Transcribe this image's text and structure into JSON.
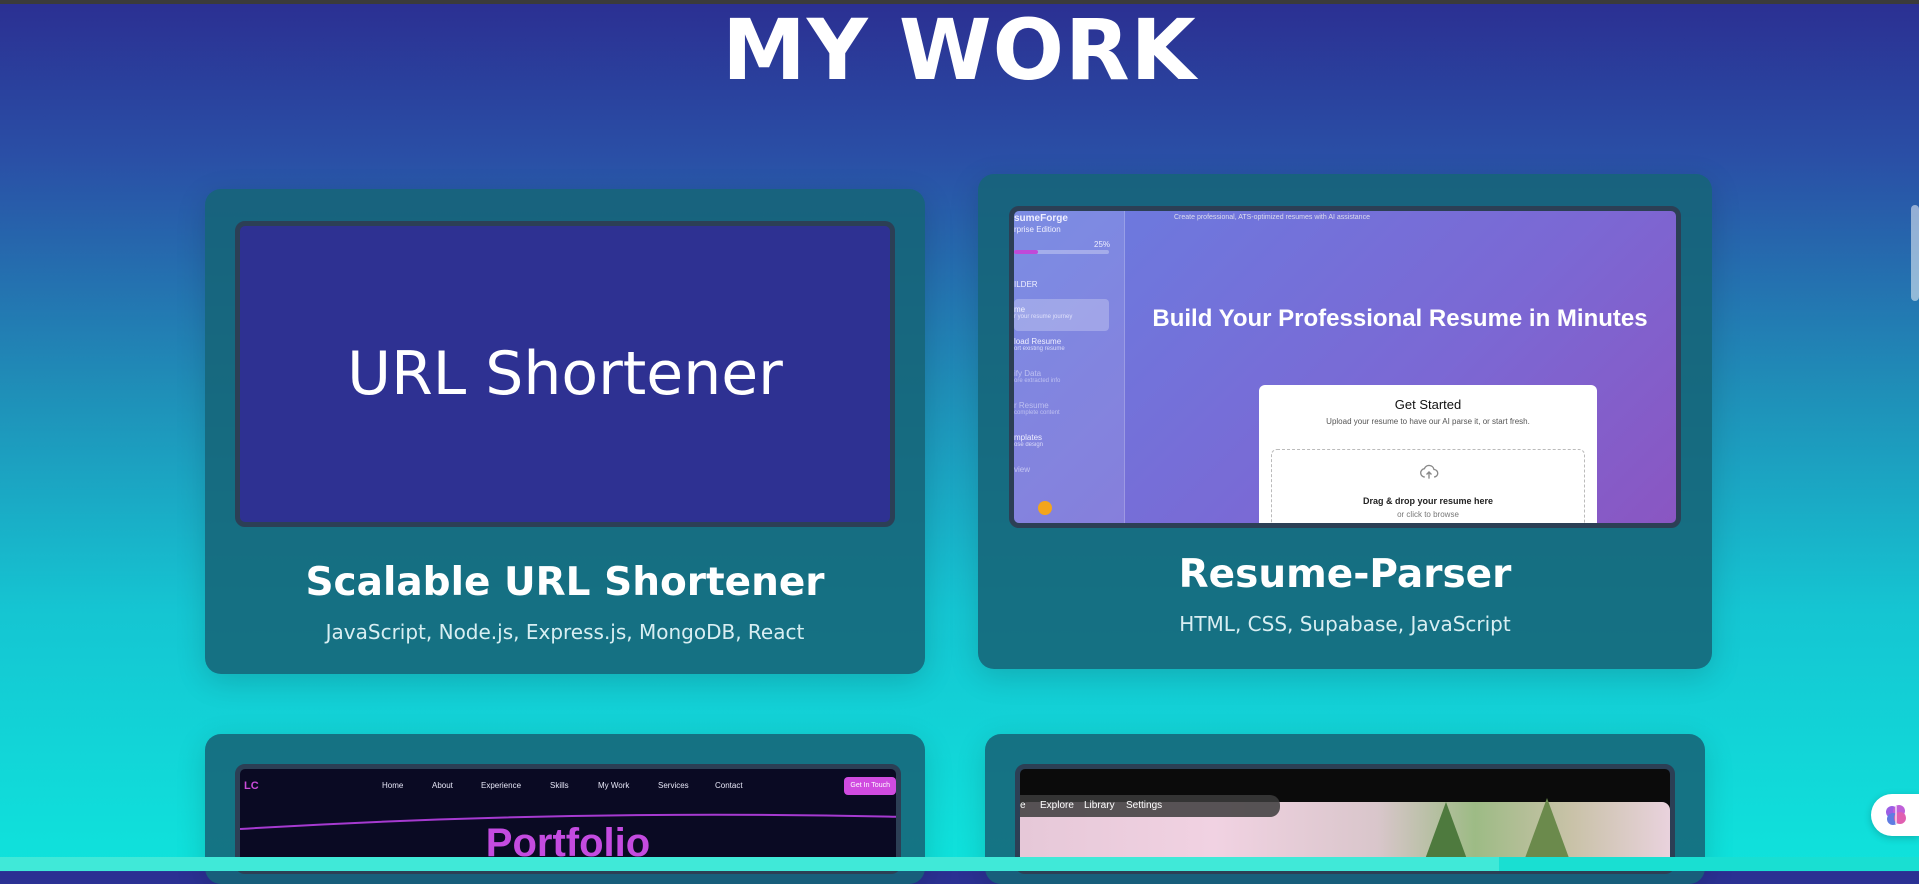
{
  "page": {
    "title": "MY WORK"
  },
  "projects": [
    {
      "thumbnail_text": "URL Shortener",
      "title": "Scalable URL Shortener",
      "tech": "JavaScript, Node.js, Express.js, MongoDB, React"
    },
    {
      "title": "Resume-Parser",
      "tech": "HTML, CSS, Supabase, JavaScript",
      "preview": {
        "app_name": "sumeForge",
        "edition": "rprise Edition",
        "progress_label": "25%",
        "progress": 0.25,
        "tagline": "Create professional, ATS-optimized resumes with AI assistance",
        "section_label": "ILDER",
        "sidebar_items": [
          {
            "label": "me",
            "sub": "r your resume journey"
          },
          {
            "label": "load Resume",
            "sub": "ort existing resume"
          },
          {
            "label": "ify Data",
            "sub": "ore extracted info"
          },
          {
            "label": "r Resume",
            "sub": "complete content"
          },
          {
            "label": "mplates",
            "sub": "ose design"
          },
          {
            "label": "view",
            "sub": ""
          }
        ],
        "headline": "Build Your Professional Resume in Minutes",
        "card_title": "Get Started",
        "card_subtitle": "Upload your resume to have our AI parse it, or start fresh.",
        "drop_title": "Drag & drop your resume here",
        "drop_sub": "or click to browse"
      }
    },
    {
      "preview": {
        "logo": "LC",
        "nav": [
          "Home",
          "About",
          "Experience",
          "Skills",
          "My Work",
          "Services",
          "Contact"
        ],
        "cta": "Get In Touch",
        "hero": "Portfolio"
      }
    },
    {
      "preview": {
        "nav": [
          "e",
          "Explore",
          "Library",
          "Settings"
        ]
      }
    }
  ],
  "colors": {
    "accent": "#c94bd8",
    "card": "#16647a",
    "url_thumb": "#2e3192"
  },
  "icons": {
    "upload": "upload-cloud-icon",
    "brain": "brain-icon"
  }
}
